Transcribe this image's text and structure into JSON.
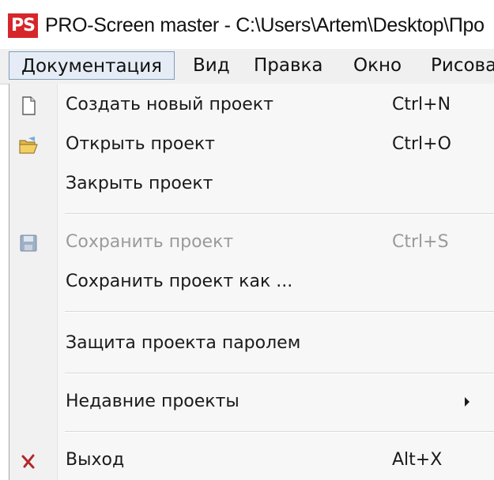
{
  "window": {
    "logo_text": "PS",
    "title": "PRO-Screen master - C:\\Users\\Artem\\Desktop\\Про"
  },
  "menubar": {
    "items": [
      {
        "label": "Документация"
      },
      {
        "label": "Вид"
      },
      {
        "label": "Правка"
      },
      {
        "label": "Окно"
      },
      {
        "label": "Рисова"
      }
    ]
  },
  "dropdown": {
    "items": [
      {
        "label": "Создать новый проект",
        "shortcut": "Ctrl+N",
        "icon": "new-document-icon",
        "enabled": true
      },
      {
        "label": "Открыть проект",
        "shortcut": "Ctrl+O",
        "icon": "open-folder-icon",
        "enabled": true
      },
      {
        "label": "Закрыть проект",
        "shortcut": "",
        "icon": "",
        "enabled": true
      },
      {
        "label": "Сохранить проект",
        "shortcut": "Ctrl+S",
        "icon": "save-icon",
        "enabled": false
      },
      {
        "label": "Сохранить проект как ...",
        "shortcut": "",
        "icon": "",
        "enabled": true
      },
      {
        "label": "Защита проекта паролем",
        "shortcut": "",
        "icon": "",
        "enabled": true
      },
      {
        "label": "Недавние проекты",
        "shortcut": "",
        "icon": "submenu-arrow-icon",
        "enabled": true
      },
      {
        "label": "Выход",
        "shortcut": "Alt+X",
        "icon": "exit-cross-icon",
        "enabled": true
      }
    ]
  },
  "colors": {
    "logo_red": "#d6262b",
    "exit_icon_red": "#b3262b",
    "disabled_text": "#9a9a9a",
    "menubar_bg": "#f0f0f0",
    "active_menu_bg": "#e5ecf5",
    "active_menu_border": "#7f9db9"
  }
}
